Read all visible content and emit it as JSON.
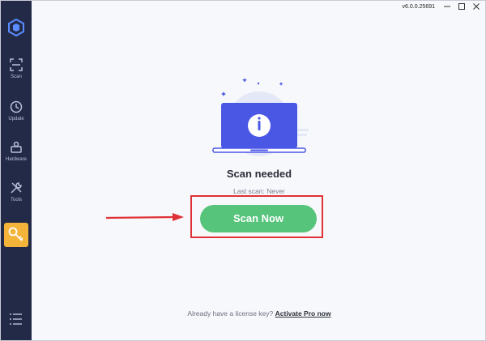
{
  "app": {
    "version": "v6.0.0.25691"
  },
  "sidebar": {
    "items": [
      {
        "label": "Scan",
        "icon": "scan-icon"
      },
      {
        "label": "Update",
        "icon": "update-icon"
      },
      {
        "label": "Hardware",
        "icon": "hardware-icon"
      },
      {
        "label": "Tools",
        "icon": "tools-icon"
      },
      {
        "label": "",
        "icon": "key-icon",
        "active": true
      }
    ],
    "colors": {
      "background": "#232a48",
      "active": "#f4b43a"
    }
  },
  "main": {
    "status_title": "Scan needed",
    "last_scan_label": "Last scan: Never",
    "scan_button_label": "Scan Now",
    "license_prompt": "Already have a license key?",
    "activate_link": "Activate Pro now"
  },
  "colors": {
    "accent": "#56c47a",
    "illustration": "#4a57e5",
    "highlight": "#e03236"
  }
}
